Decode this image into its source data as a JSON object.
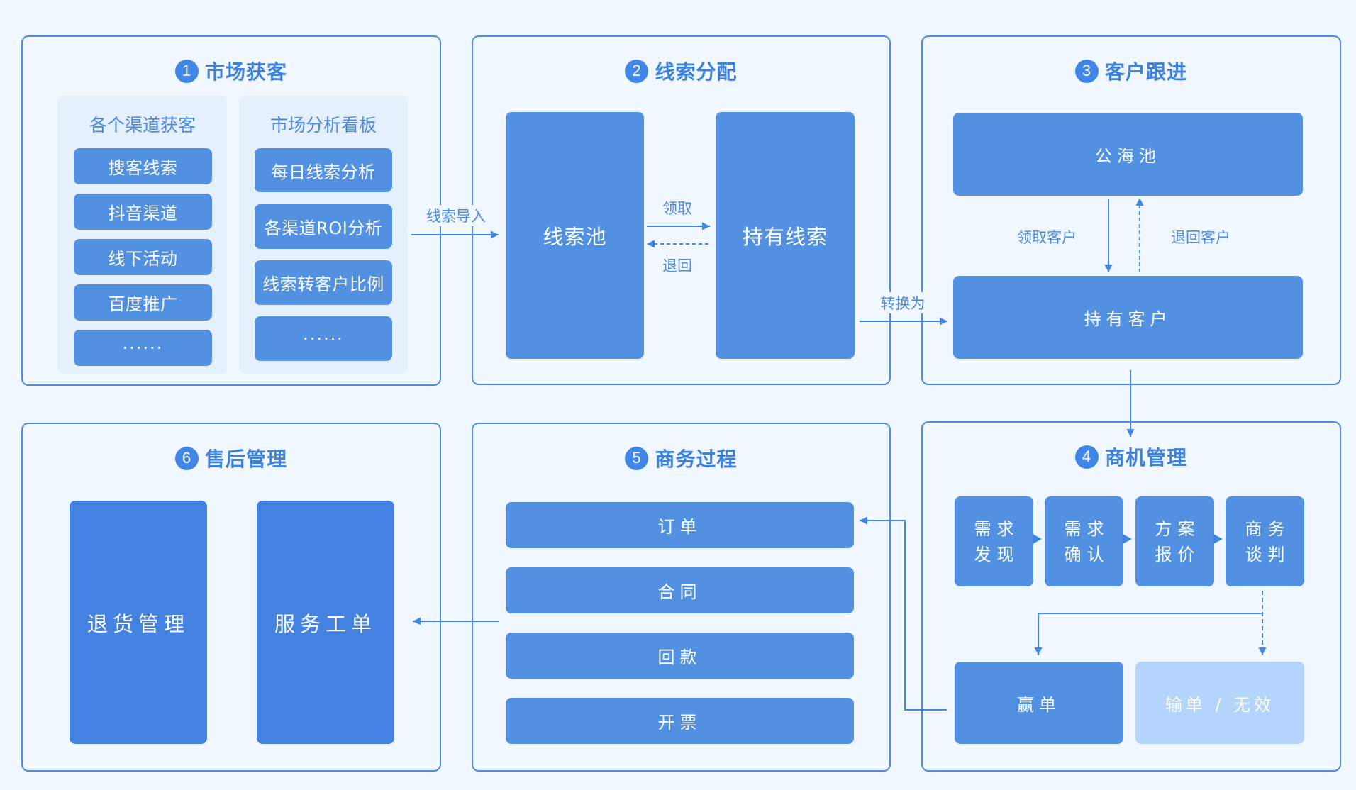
{
  "colors": {
    "background": "#f1f7fe",
    "panel_border": "#4d8ce2",
    "title_text": "#3d82df",
    "box": "#5290e2",
    "box_dark": "#4382e0",
    "box_inactive": "#b3d4fb",
    "subcolumn_bg": "#e6f0fd"
  },
  "panels": {
    "market": {
      "number": "1",
      "title": "市场获客",
      "channels": {
        "title": "各个渠道获客",
        "items": [
          "搜客线索",
          "抖音渠道",
          "线下活动",
          "百度推广",
          "······"
        ]
      },
      "dashboard": {
        "title": "市场分析看板",
        "items": [
          "每日线索分析",
          "各渠道ROI分析",
          "线索转客户比例",
          "······"
        ]
      }
    },
    "lead_assign": {
      "number": "2",
      "title": "线索分配",
      "pool": "线索池",
      "held": "持有线索",
      "claim_label": "领取",
      "return_label": "退回"
    },
    "customer_follow": {
      "number": "3",
      "title": "客户跟进",
      "public_pool": "公海池",
      "held_customers": "持有客户",
      "claim_label": "领取客户",
      "return_label": "退回客户"
    },
    "opportunity": {
      "number": "4",
      "title": "商机管理",
      "stages": [
        "需求\n发现",
        "需求\n确认",
        "方案\n报价",
        "商务\n谈判"
      ],
      "won": "赢单",
      "lost": "输单 / 无效"
    },
    "business_process": {
      "number": "5",
      "title": "商务过程",
      "items": [
        "订单",
        "合同",
        "回款",
        "开票"
      ]
    },
    "after_sales": {
      "number": "6",
      "title": "售后管理",
      "items": [
        "退货管理",
        "服务工单"
      ]
    }
  },
  "connectors": {
    "import_label": "线索导入",
    "convert_label": "转换为"
  }
}
